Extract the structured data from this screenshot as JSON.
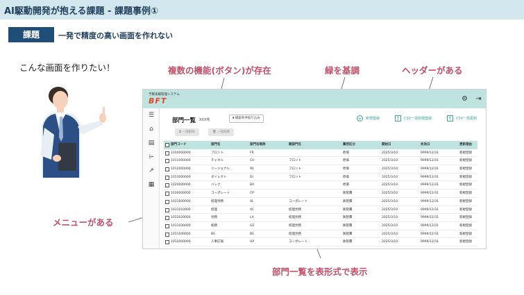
{
  "slide": {
    "title": "AI駆動開発が抱える課題 - 課題事例①",
    "tag": "課題",
    "tag_text": "一発で精度の高い画面を作れない",
    "intro": "こんな画面を作りたい！"
  },
  "callouts": {
    "buttons": "複数の機能(ボタン)が存在",
    "green": "緑を基調",
    "header": "ヘッダーがある",
    "menu": "メニューがある",
    "table": "部門一覧を表形式で表示"
  },
  "colors": {
    "header_band": "#d3e7ef",
    "tag_bg": "#1f4e79",
    "callout": "#c0506b",
    "app_header": "#bfe3de",
    "accent": "#3aa59a",
    "logo": "#e24a2a"
  },
  "app": {
    "system_name": "予算実績管理システム",
    "logo": "BFT",
    "header_icons": [
      "gear-icon",
      "logout-icon"
    ],
    "sidebar_icons": [
      "menu-icon",
      "home-icon",
      "id-card-icon",
      "tag-icon",
      "chart-icon",
      "settings-list-icon"
    ],
    "page_title": "部門一覧",
    "count": "XXX件",
    "filter_label": "検索条件絞り込み",
    "actions": [
      "新規登録",
      "CSV一括新規登録",
      "CSV一括更新"
    ],
    "sub_actions": [
      "一括削除",
      "一括削除"
    ],
    "table": {
      "headers": [
        "部門コード",
        "部門名",
        "部門名略称",
        "親部門名",
        "費用区分",
        "開始日",
        "失効日",
        "更新理由"
      ],
      "rows": [
        [
          "1010000000",
          "フロント",
          "FR",
          "",
          "原価",
          "2025/3/10",
          "9999/12/31",
          "新規登録"
        ],
        [
          "1011000000",
          "チャネル",
          "CH",
          "フロント",
          "原価",
          "2025/3/10",
          "9999/12/31",
          "新規登録"
        ],
        [
          "1012000000",
          "リージョナル",
          "RE",
          "フロント",
          "原価",
          "2025/3/10",
          "9999/12/31",
          "新規登録"
        ],
        [
          "1013000000",
          "ダイレクト",
          "DI",
          "フロント",
          "原価",
          "2025/3/10",
          "9999/12/31",
          "新規登録"
        ],
        [
          "1020000000",
          "バック",
          "BA",
          "",
          "原価",
          "2025/3/10",
          "9999/12/31",
          "新規登録"
        ],
        [
          "1030000000",
          "コーポレート",
          "CP",
          "",
          "販管費",
          "2025/3/10",
          "9999/12/31",
          "新規登録"
        ],
        [
          "1031000000",
          "経理労務",
          "AL",
          "コーポレート",
          "販管費",
          "2025/3/10",
          "9999/12/31",
          "新規登録"
        ],
        [
          "1031010000",
          "経理",
          "AC",
          "経理労務",
          "販管費",
          "2025/3/10",
          "9999/12/31",
          "新規登録"
        ],
        [
          "1031020000",
          "労務",
          "LA",
          "経理労務",
          "販管費",
          "2025/3/10",
          "9999/12/31",
          "新規登録"
        ],
        [
          "1031030000",
          "総務",
          "GE",
          "経理労務",
          "販管費",
          "2025/3/10",
          "9999/12/31",
          "新規登録"
        ],
        [
          "1031040000",
          "BS",
          "BS",
          "経理労務",
          "販管費",
          "2025/3/10",
          "9999/12/31",
          "新規登録"
        ],
        [
          "1032000000",
          "人事広報",
          "HP",
          "コーポレート",
          "販管費",
          "2025/3/10",
          "9999/12/31",
          "新規登録"
        ]
      ]
    }
  }
}
